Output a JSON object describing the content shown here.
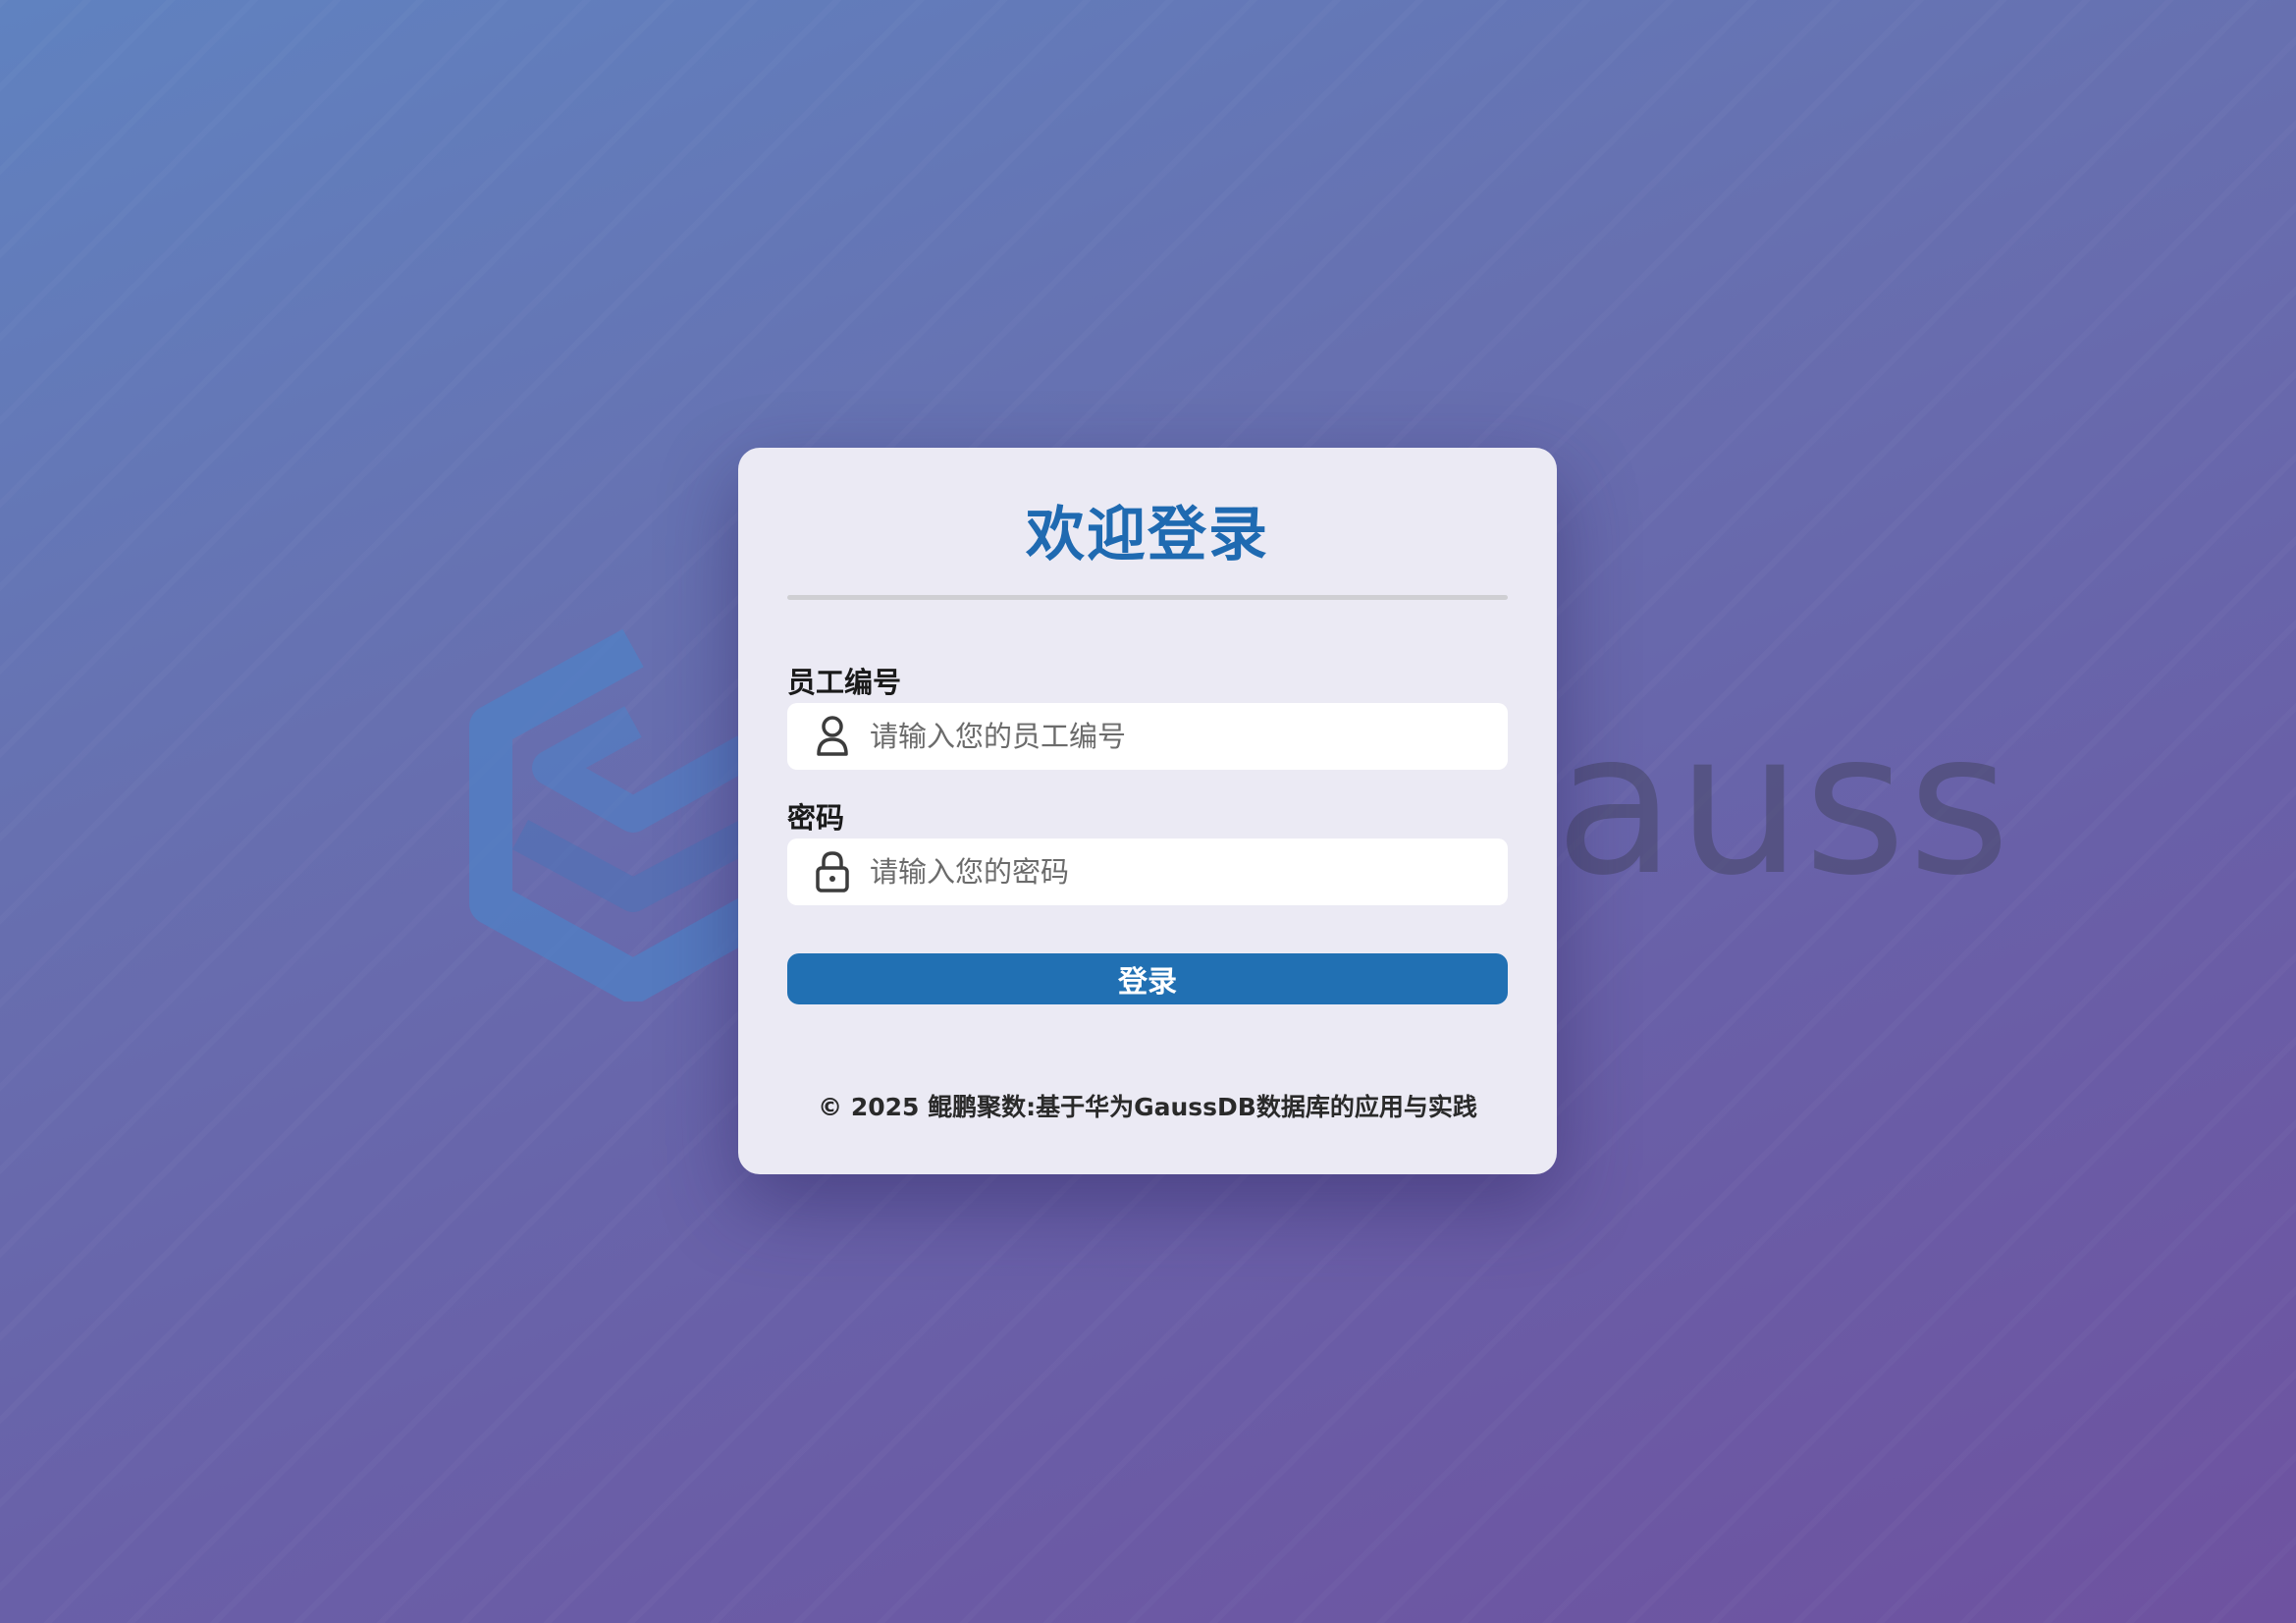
{
  "background": {
    "brand_text": "openGauss",
    "colors": {
      "gradient_start": "#6082c0",
      "gradient_end": "#6e52a0",
      "logo": "#4f7fc4"
    }
  },
  "login_card": {
    "title": "欢迎登录",
    "employee_id": {
      "label": "员工编号",
      "placeholder": "请输入您的员工编号",
      "value": "",
      "icon": "user-icon"
    },
    "password": {
      "label": "密码",
      "placeholder": "请输入您的密码",
      "value": "",
      "icon": "lock-icon"
    },
    "login_button_label": "登录",
    "footer_text": "© 2025 鲲鹏聚数:基于华为GaussDB数据库的应用与实践",
    "colors": {
      "title": "#1f6ab1",
      "button": "#2170b3",
      "card": "#ebeaf4"
    }
  }
}
